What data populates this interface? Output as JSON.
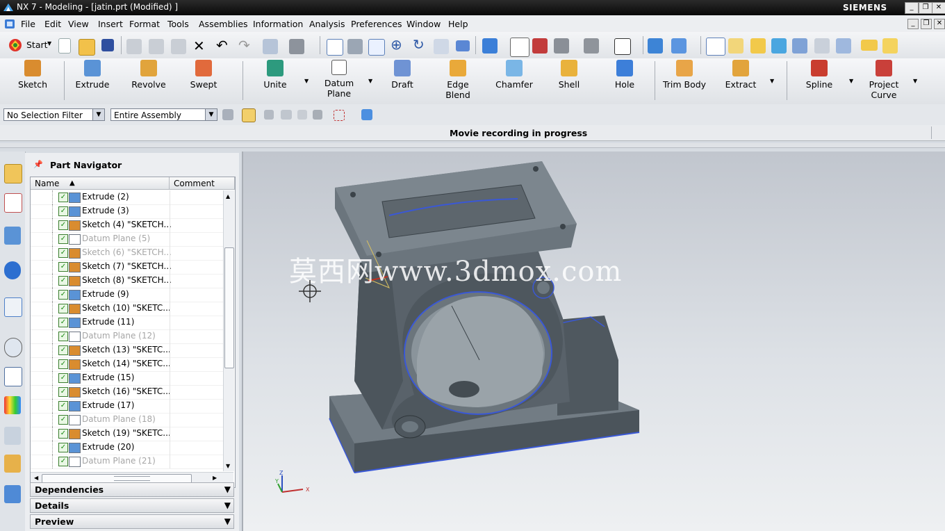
{
  "window": {
    "title": "NX 7 - Modeling - [jatin.prt (Modified) ]",
    "brand": "SIEMENS",
    "controls": [
      "_",
      "❐",
      "✕"
    ]
  },
  "menubar": {
    "items": [
      "File",
      "Edit",
      "View",
      "Insert",
      "Format",
      "Tools",
      "Assemblies",
      "Information",
      "Analysis",
      "Preferences",
      "Window",
      "Help"
    ]
  },
  "toolbar": {
    "start_label": "Start",
    "feature_buttons": [
      "Sketch",
      "Extrude",
      "Revolve",
      "Swept",
      "Unite",
      "Datum Plane",
      "Draft",
      "Edge Blend",
      "Chamfer",
      "Shell",
      "Hole",
      "Trim Body",
      "Extract",
      "Spline",
      "Project Curve"
    ]
  },
  "selection": {
    "filter": "No Selection Filter",
    "scope": "Entire Assembly"
  },
  "status": {
    "message": "Movie recording in progress"
  },
  "navigator": {
    "title": "Part Navigator",
    "columns": [
      "Name",
      "Comment"
    ],
    "rows": [
      {
        "label": "Extrude (2)",
        "icon": "extrude-icon",
        "dim": false
      },
      {
        "label": "Extrude (3)",
        "icon": "extrude-icon",
        "dim": false
      },
      {
        "label": "Sketch (4) \"SKETCH...",
        "icon": "sketch-icon",
        "dim": false
      },
      {
        "label": "Datum Plane (5)",
        "icon": "datum-plane-icon",
        "dim": true
      },
      {
        "label": "Sketch (6) \"SKETCH...",
        "icon": "sketch-icon",
        "dim": true
      },
      {
        "label": "Sketch (7) \"SKETCH...",
        "icon": "sketch-icon",
        "dim": false
      },
      {
        "label": "Sketch (8) \"SKETCH...",
        "icon": "sketch-icon",
        "dim": false
      },
      {
        "label": "Extrude (9)",
        "icon": "extrude-icon",
        "dim": false
      },
      {
        "label": "Sketch (10) \"SKETC...",
        "icon": "sketch-icon",
        "dim": false
      },
      {
        "label": "Extrude (11)",
        "icon": "extrude-icon",
        "dim": false
      },
      {
        "label": "Datum Plane (12)",
        "icon": "datum-plane-icon",
        "dim": true
      },
      {
        "label": "Sketch (13) \"SKETC...",
        "icon": "sketch-icon",
        "dim": false
      },
      {
        "label": "Sketch (14) \"SKETC...",
        "icon": "sketch-icon",
        "dim": false
      },
      {
        "label": "Extrude (15)",
        "icon": "extrude-icon",
        "dim": false
      },
      {
        "label": "Sketch (16) \"SKETC...",
        "icon": "sketch-icon",
        "dim": false
      },
      {
        "label": "Extrude (17)",
        "icon": "extrude-icon",
        "dim": false
      },
      {
        "label": "Datum Plane (18)",
        "icon": "datum-plane-icon",
        "dim": true
      },
      {
        "label": "Sketch (19) \"SKETC...",
        "icon": "sketch-icon",
        "dim": false
      },
      {
        "label": "Extrude (20)",
        "icon": "extrude-icon",
        "dim": false
      },
      {
        "label": "Datum Plane (21)",
        "icon": "datum-plane-icon",
        "dim": true
      }
    ],
    "panels": [
      "Dependencies",
      "Details",
      "Preview"
    ]
  },
  "viewport": {
    "watermark": "莫西网www.3dmox.com",
    "triad_labels": [
      "Z",
      "Y",
      "X"
    ]
  }
}
